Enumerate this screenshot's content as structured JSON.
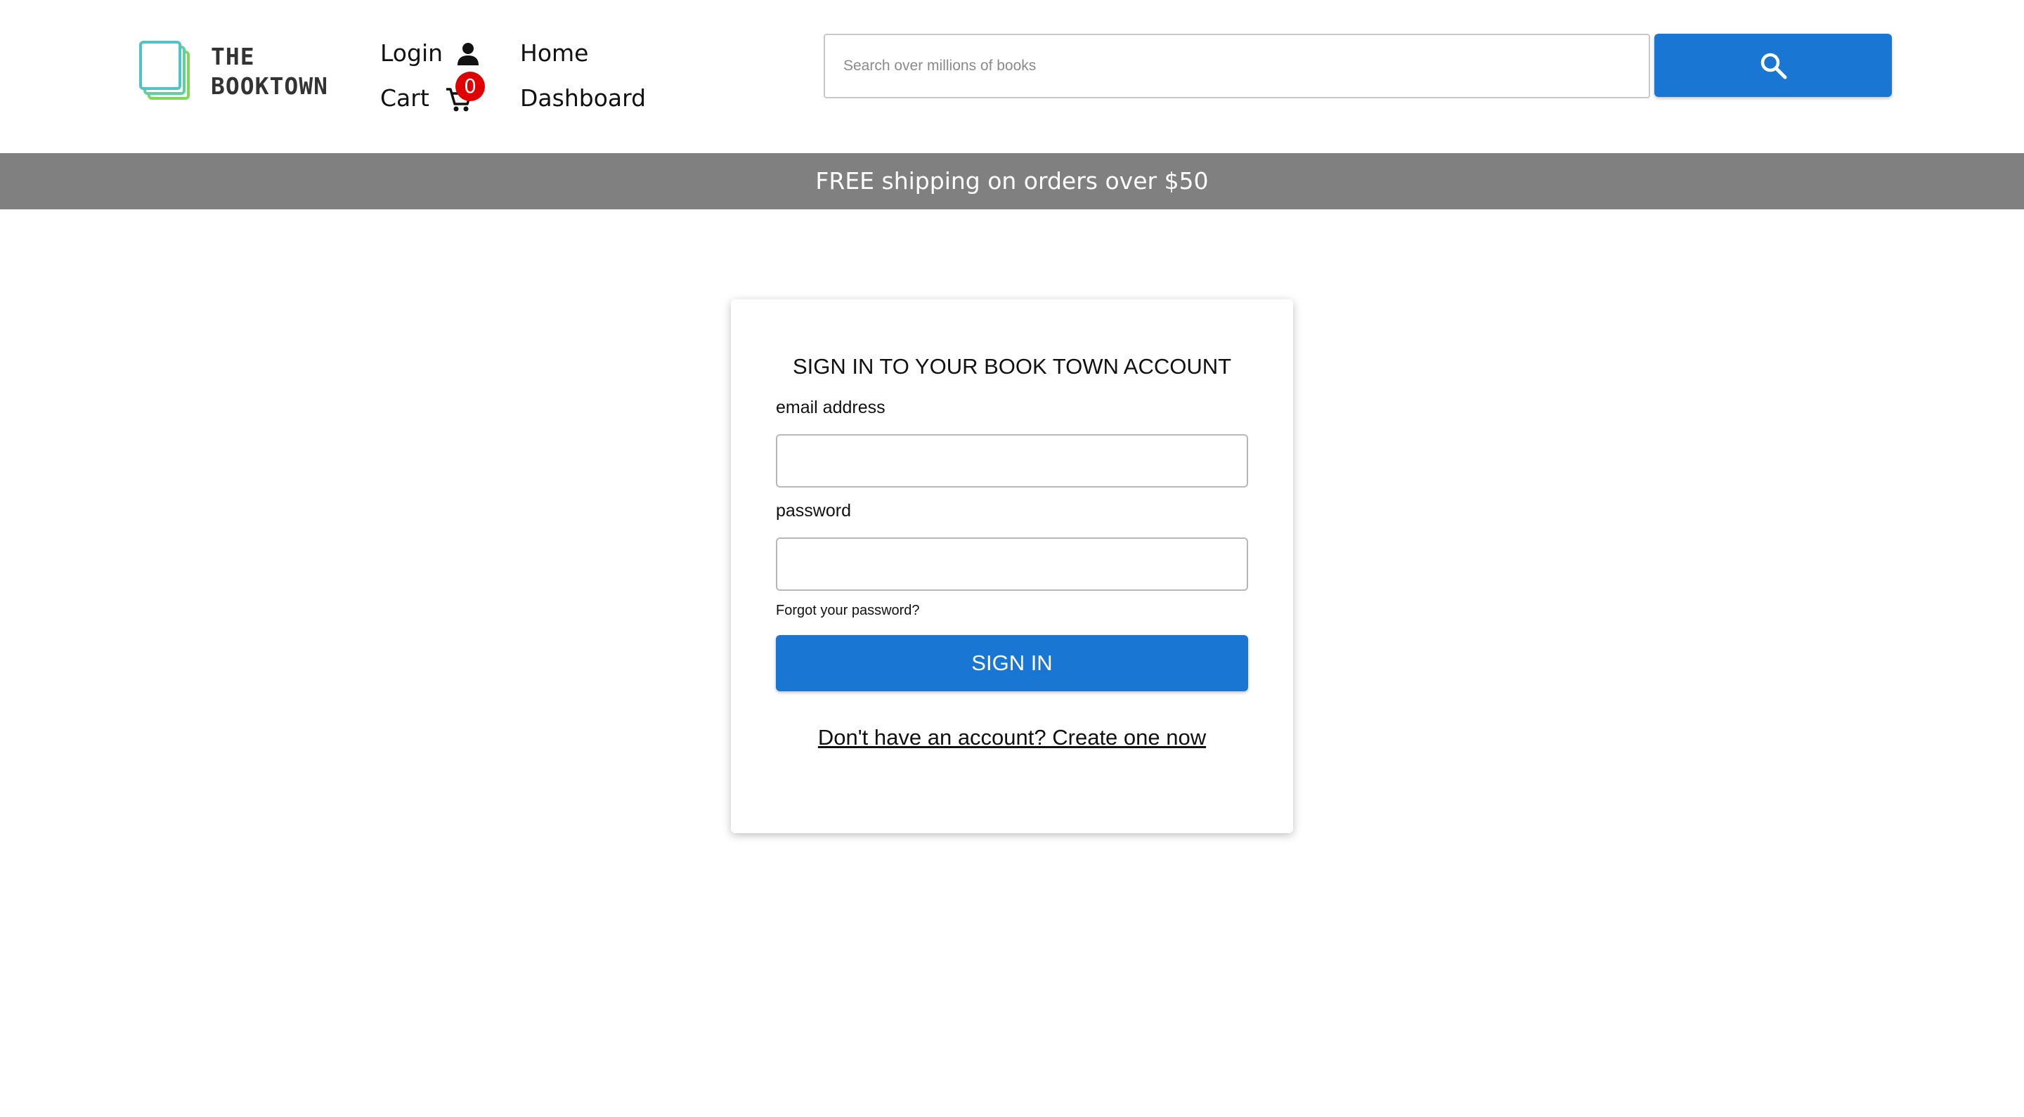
{
  "header": {
    "logo": {
      "line1": "THE",
      "line2": "BOOKTOWN",
      "icon": "book-stack-icon"
    },
    "nav": {
      "login": "Login",
      "cart": "Cart",
      "home": "Home",
      "dashboard": "Dashboard"
    },
    "cart_count": "0",
    "search": {
      "placeholder": "Search over millions of books",
      "value": "",
      "button_icon": "search-icon"
    }
  },
  "banner": {
    "text": "FREE shipping on orders over $50"
  },
  "signin": {
    "title": "SIGN IN TO YOUR BOOK TOWN ACCOUNT",
    "email_label": "email address",
    "email_value": "",
    "password_label": "password",
    "password_value": "",
    "forgot_link": "Forgot your password?",
    "submit_label": "SIGN IN",
    "create_account_link": "Don't have an account? Create one now"
  },
  "colors": {
    "accent": "#1976d2",
    "banner_bg": "#808080",
    "badge": "#e00000",
    "logo_green": "#7ed957",
    "logo_teal": "#4fc3c7"
  }
}
